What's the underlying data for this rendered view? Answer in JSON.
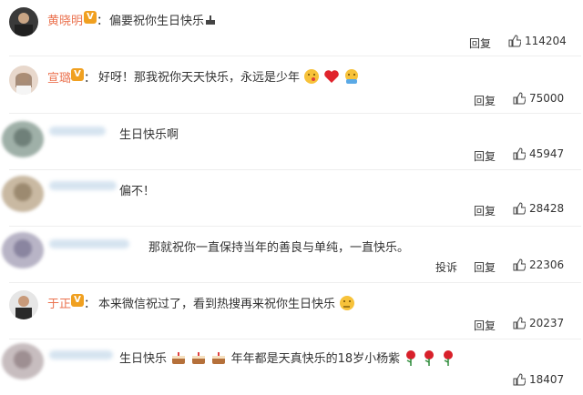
{
  "actions": {
    "reply": "回复",
    "report": "投诉"
  },
  "comments": [
    {
      "user": "黄晓明",
      "sep": "：",
      "text": "偏要祝你生日快乐",
      "likes": "114204"
    },
    {
      "user": "宣璐",
      "sep": "：",
      "text": "好呀！那我祝你天天快乐，永远是少年",
      "likes": "75000"
    },
    {
      "text": "生日快乐啊",
      "likes": "45947"
    },
    {
      "text": "偏不！",
      "likes": "28428"
    },
    {
      "text": "那就祝你一直保持当年的善良与单纯，一直快乐。",
      "likes": "22306"
    },
    {
      "user": "于正",
      "sep": "：",
      "text": "本来微信祝过了，看到热搜再来祝你生日快乐",
      "likes": "20237"
    },
    {
      "text_a": "生日快乐",
      "text_b": "年年都是天真快乐的18岁小杨紫",
      "likes": "18407"
    }
  ],
  "icons": {
    "verified": "verified-v-badge",
    "like": "thumbs-up-icon",
    "cake": "cake-emoji",
    "rose": "rose-emoji"
  },
  "colors": {
    "username": "#eb7350",
    "verified_badge": "#f0a020",
    "separator": "#eeeeee"
  }
}
